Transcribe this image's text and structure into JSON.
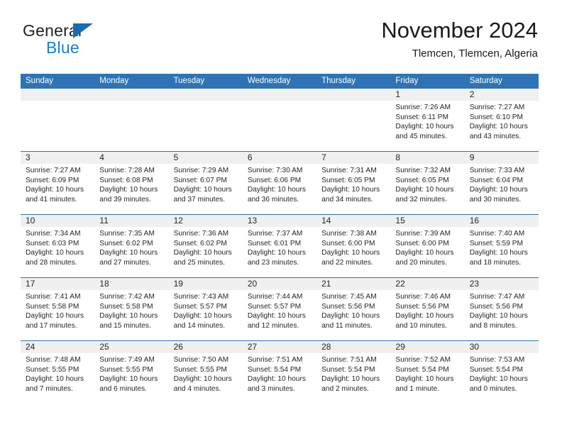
{
  "logo": {
    "word_one": "General",
    "word_two": "Blue",
    "triangle_color": "#1a6bb5",
    "blue_text_color": "#1a7fd4"
  },
  "header": {
    "title": "November 2024",
    "subtitle": "Tlemcen, Tlemcen, Algeria",
    "accent_color": "#2E74B5",
    "band_color": "#f0f0f0"
  },
  "calendar": {
    "weekday_headers": [
      "Sunday",
      "Monday",
      "Tuesday",
      "Wednesday",
      "Thursday",
      "Friday",
      "Saturday"
    ],
    "weeks": [
      [
        {
          "day": "",
          "empty": true
        },
        {
          "day": "",
          "empty": true
        },
        {
          "day": "",
          "empty": true
        },
        {
          "day": "",
          "empty": true
        },
        {
          "day": "",
          "empty": true
        },
        {
          "day": "1",
          "sunrise": "Sunrise: 7:26 AM",
          "sunset": "Sunset: 6:11 PM",
          "daylight": "Daylight: 10 hours and 45 minutes."
        },
        {
          "day": "2",
          "sunrise": "Sunrise: 7:27 AM",
          "sunset": "Sunset: 6:10 PM",
          "daylight": "Daylight: 10 hours and 43 minutes."
        }
      ],
      [
        {
          "day": "3",
          "sunrise": "Sunrise: 7:27 AM",
          "sunset": "Sunset: 6:09 PM",
          "daylight": "Daylight: 10 hours and 41 minutes."
        },
        {
          "day": "4",
          "sunrise": "Sunrise: 7:28 AM",
          "sunset": "Sunset: 6:08 PM",
          "daylight": "Daylight: 10 hours and 39 minutes."
        },
        {
          "day": "5",
          "sunrise": "Sunrise: 7:29 AM",
          "sunset": "Sunset: 6:07 PM",
          "daylight": "Daylight: 10 hours and 37 minutes."
        },
        {
          "day": "6",
          "sunrise": "Sunrise: 7:30 AM",
          "sunset": "Sunset: 6:06 PM",
          "daylight": "Daylight: 10 hours and 36 minutes."
        },
        {
          "day": "7",
          "sunrise": "Sunrise: 7:31 AM",
          "sunset": "Sunset: 6:05 PM",
          "daylight": "Daylight: 10 hours and 34 minutes."
        },
        {
          "day": "8",
          "sunrise": "Sunrise: 7:32 AM",
          "sunset": "Sunset: 6:05 PM",
          "daylight": "Daylight: 10 hours and 32 minutes."
        },
        {
          "day": "9",
          "sunrise": "Sunrise: 7:33 AM",
          "sunset": "Sunset: 6:04 PM",
          "daylight": "Daylight: 10 hours and 30 minutes."
        }
      ],
      [
        {
          "day": "10",
          "sunrise": "Sunrise: 7:34 AM",
          "sunset": "Sunset: 6:03 PM",
          "daylight": "Daylight: 10 hours and 28 minutes."
        },
        {
          "day": "11",
          "sunrise": "Sunrise: 7:35 AM",
          "sunset": "Sunset: 6:02 PM",
          "daylight": "Daylight: 10 hours and 27 minutes."
        },
        {
          "day": "12",
          "sunrise": "Sunrise: 7:36 AM",
          "sunset": "Sunset: 6:02 PM",
          "daylight": "Daylight: 10 hours and 25 minutes."
        },
        {
          "day": "13",
          "sunrise": "Sunrise: 7:37 AM",
          "sunset": "Sunset: 6:01 PM",
          "daylight": "Daylight: 10 hours and 23 minutes."
        },
        {
          "day": "14",
          "sunrise": "Sunrise: 7:38 AM",
          "sunset": "Sunset: 6:00 PM",
          "daylight": "Daylight: 10 hours and 22 minutes."
        },
        {
          "day": "15",
          "sunrise": "Sunrise: 7:39 AM",
          "sunset": "Sunset: 6:00 PM",
          "daylight": "Daylight: 10 hours and 20 minutes."
        },
        {
          "day": "16",
          "sunrise": "Sunrise: 7:40 AM",
          "sunset": "Sunset: 5:59 PM",
          "daylight": "Daylight: 10 hours and 18 minutes."
        }
      ],
      [
        {
          "day": "17",
          "sunrise": "Sunrise: 7:41 AM",
          "sunset": "Sunset: 5:58 PM",
          "daylight": "Daylight: 10 hours and 17 minutes."
        },
        {
          "day": "18",
          "sunrise": "Sunrise: 7:42 AM",
          "sunset": "Sunset: 5:58 PM",
          "daylight": "Daylight: 10 hours and 15 minutes."
        },
        {
          "day": "19",
          "sunrise": "Sunrise: 7:43 AM",
          "sunset": "Sunset: 5:57 PM",
          "daylight": "Daylight: 10 hours and 14 minutes."
        },
        {
          "day": "20",
          "sunrise": "Sunrise: 7:44 AM",
          "sunset": "Sunset: 5:57 PM",
          "daylight": "Daylight: 10 hours and 12 minutes."
        },
        {
          "day": "21",
          "sunrise": "Sunrise: 7:45 AM",
          "sunset": "Sunset: 5:56 PM",
          "daylight": "Daylight: 10 hours and 11 minutes."
        },
        {
          "day": "22",
          "sunrise": "Sunrise: 7:46 AM",
          "sunset": "Sunset: 5:56 PM",
          "daylight": "Daylight: 10 hours and 10 minutes."
        },
        {
          "day": "23",
          "sunrise": "Sunrise: 7:47 AM",
          "sunset": "Sunset: 5:56 PM",
          "daylight": "Daylight: 10 hours and 8 minutes."
        }
      ],
      [
        {
          "day": "24",
          "sunrise": "Sunrise: 7:48 AM",
          "sunset": "Sunset: 5:55 PM",
          "daylight": "Daylight: 10 hours and 7 minutes."
        },
        {
          "day": "25",
          "sunrise": "Sunrise: 7:49 AM",
          "sunset": "Sunset: 5:55 PM",
          "daylight": "Daylight: 10 hours and 6 minutes."
        },
        {
          "day": "26",
          "sunrise": "Sunrise: 7:50 AM",
          "sunset": "Sunset: 5:55 PM",
          "daylight": "Daylight: 10 hours and 4 minutes."
        },
        {
          "day": "27",
          "sunrise": "Sunrise: 7:51 AM",
          "sunset": "Sunset: 5:54 PM",
          "daylight": "Daylight: 10 hours and 3 minutes."
        },
        {
          "day": "28",
          "sunrise": "Sunrise: 7:51 AM",
          "sunset": "Sunset: 5:54 PM",
          "daylight": "Daylight: 10 hours and 2 minutes."
        },
        {
          "day": "29",
          "sunrise": "Sunrise: 7:52 AM",
          "sunset": "Sunset: 5:54 PM",
          "daylight": "Daylight: 10 hours and 1 minute."
        },
        {
          "day": "30",
          "sunrise": "Sunrise: 7:53 AM",
          "sunset": "Sunset: 5:54 PM",
          "daylight": "Daylight: 10 hours and 0 minutes."
        }
      ]
    ]
  }
}
